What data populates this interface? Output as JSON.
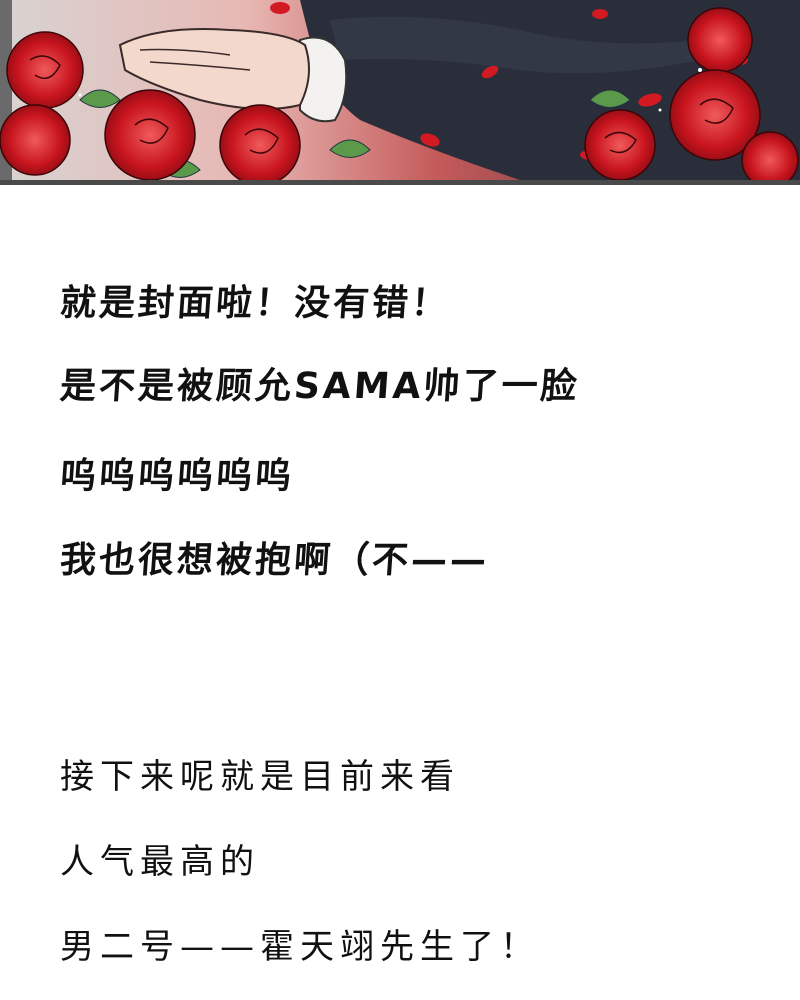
{
  "lines_top": [
    "就是封面啦！没有错！",
    "是不是被顾允SAMA帅了一脸",
    "呜呜呜呜呜呜",
    "我也很想被抱啊（不——"
  ],
  "lines_bottom": [
    "接下来呢就是目前来看",
    "人气最高的",
    "男二号——霍天翊先生了！"
  ],
  "colors": {
    "text": "#111111",
    "rose_red": "#c8141e",
    "frame": "#555555",
    "suit": "#2a2e3a"
  }
}
